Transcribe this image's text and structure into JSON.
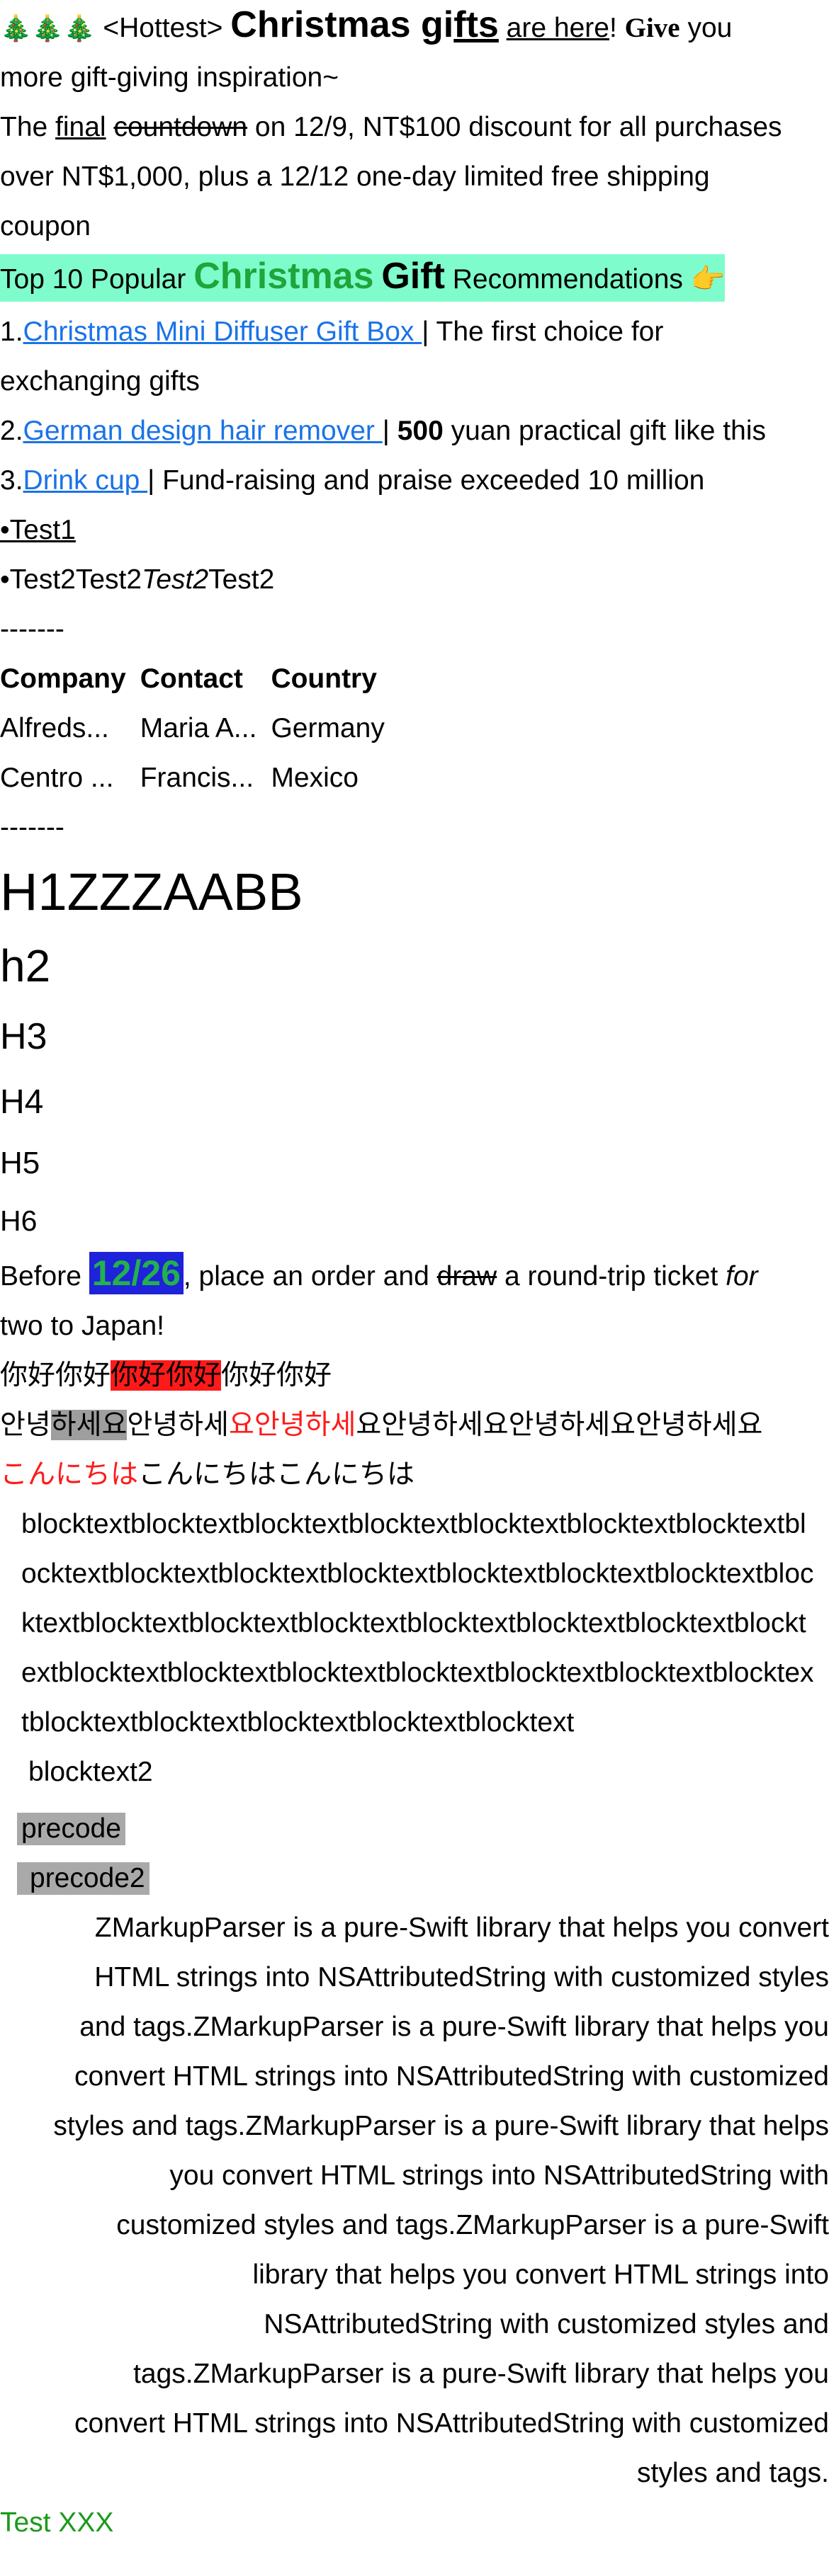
{
  "header": {
    "trees": "🎄🎄🎄",
    "hottest": "<Hottest>",
    "christmas_gi": "Christmas gi",
    "fts": "fts",
    "space": " ",
    "are_here": "are here",
    "excl": "!",
    "give": "Give",
    "you": " you",
    "line2": "more gift-giving inspiration~"
  },
  "promo": {
    "the": "The ",
    "final": "final",
    "countdown": "countdown",
    "rest1": " on 12/9, NT$100 discount for all purchases",
    "line2": "over NT$1,000, plus a 12/12 one-day limited free shipping",
    "line3": "coupon"
  },
  "top10": {
    "prefix": "Top 10 Popular ",
    "christmas": "Christmas",
    "gift": "Gift",
    "suffix": " Recommendations 👉"
  },
  "list": [
    {
      "num": " 1.",
      "link": "Christmas Mini Diffuser Gift Box ",
      "sep": " | ",
      "desc": " The first choice for",
      "desc2": "exchanging gifts"
    },
    {
      "num": " 2.",
      "link": "German design hair remover ",
      "sep": " | ",
      "bold": "500",
      "desc": " yuan practical gift like this"
    },
    {
      "num": " 3.",
      "link": "Drink cup ",
      "sep": " | ",
      "desc": " Fund-raising and praise exceeded 10 million"
    }
  ],
  "bullets": {
    "b1": " •Test1",
    "b2_dot": " •",
    "b2_a": "Test2Test2",
    "b2_i": "Test2",
    "b2_b": "Test2"
  },
  "divider": "-------",
  "table": {
    "headers": [
      "Company",
      "Contact",
      "Country"
    ],
    "rows": [
      [
        "Alfreds...",
        "Maria A...",
        "Germany"
      ],
      [
        "Centro ...",
        "Francis...",
        "Mexico"
      ]
    ]
  },
  "headings": {
    "h1": "H1ZZZAABB",
    "h2": "h2",
    "h3": "H3",
    "h4": "H4",
    "h5": "H5",
    "h6": "H6"
  },
  "before": {
    "before": "Before ",
    "date": "12/26",
    "mid": ", place an order and ",
    "draw": "draw",
    "rest": " a round-trip ticket ",
    "for": "for",
    "line2": "two to Japan!"
  },
  "chinese": {
    "a": "你好你好",
    "b": "你好你好",
    "c": "你好你好"
  },
  "korean": {
    "a": "안녕",
    "b": "하세요",
    "c": "안녕하세",
    "d": "요안녕하세",
    "e": "요안녕하세요안녕하세요안녕하세요"
  },
  "japanese": {
    "a": "こんにちは",
    "b": "こんにちはこんにちは"
  },
  "blocktext": "blocktextblocktextblocktextblocktextblocktextblocktextblocktextblocktextblocktextblocktextblocktextblocktextblocktextblocktextblocktextblocktextblocktextblocktextblocktextblocktextblocktextblocktextblocktextblocktextblocktextblocktextblocktextblocktextblocktextblocktextblocktextblocktextblocktextblocktext",
  "blocktext2": "blocktext2",
  "precode": "precode",
  "precode2": "precode2",
  "paragraph": [
    "ZMarkupParser is a pure-Swift library that helps you convert",
    "HTML strings into NSAttributedString with customized styles",
    "and tags.ZMarkupParser is a pure-Swift library that helps you",
    "convert HTML strings into NSAttributedString with customized",
    "styles and tags.ZMarkupParser is a pure-Swift library that helps",
    "you convert HTML strings into NSAttributedString with",
    "customized styles and tags.ZMarkupParser is a pure-Swift",
    "library that helps you convert HTML strings into",
    "NSAttributedString with customized styles and",
    "tags.ZMarkupParser is a pure-Swift library that helps you",
    "convert HTML strings into NSAttributedString with customized",
    "styles and tags."
  ],
  "footer": "Test XXX",
  "colors": {
    "link": "#1a73e8",
    "highlight": "#7ffccb",
    "green": "#1fa53a",
    "date_bg": "#1e22d9",
    "red": "#ff1a1a",
    "gray": "#9e9e9e"
  }
}
